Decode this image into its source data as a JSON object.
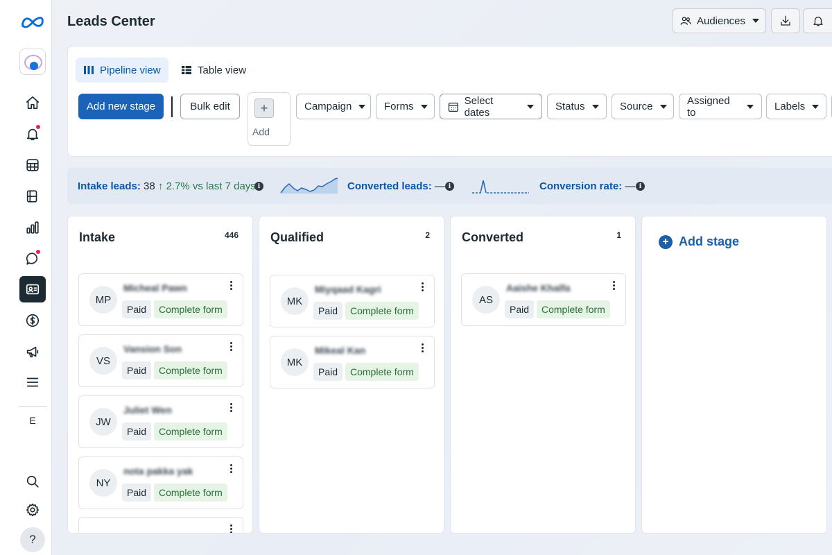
{
  "app": {
    "title": "Leads Center"
  },
  "header": {
    "audiences_label": "Audiences"
  },
  "rail": {
    "workspace_letter": "E",
    "help_label": "?"
  },
  "views": {
    "pipeline": "Pipeline view",
    "table": "Table view"
  },
  "toolbar": {
    "add_stage_button": "Add new stage",
    "bulk_edit": "Bulk edit",
    "add_label": "Add",
    "add_plus": "+",
    "filters": {
      "campaign": "Campaign",
      "forms": "Forms",
      "dates": "Select dates",
      "status": "Status",
      "source": "Source",
      "assigned": "Assigned to",
      "labels": "Labels"
    }
  },
  "stats": {
    "intake_label": "Intake leads:",
    "intake_value": "38",
    "intake_delta": "↑ 2.7% vs last 7 days",
    "converted_label": "Converted leads:",
    "converted_value": "—",
    "rate_label": "Conversion rate:",
    "rate_value": "—",
    "info_glyph": "i"
  },
  "columns": [
    {
      "title": "Intake",
      "count": "446",
      "cards": [
        {
          "initials": "MP",
          "name": "Micheal Pawn",
          "tag1": "Paid",
          "tag2": "Complete form"
        },
        {
          "initials": "VS",
          "name": "Vansion Son",
          "tag1": "Paid",
          "tag2": "Complete form"
        },
        {
          "initials": "JW",
          "name": "Juliet Wen",
          "tag1": "Paid",
          "tag2": "Complete form"
        },
        {
          "initials": "NY",
          "name": "nota pakka yak",
          "tag1": "Paid",
          "tag2": "Complete form"
        }
      ]
    },
    {
      "title": "Qualified",
      "count": "2",
      "cards": [
        {
          "initials": "MK",
          "name": "Miyqaad Kagri",
          "tag1": "Paid",
          "tag2": "Complete form"
        },
        {
          "initials": "MK",
          "name": "Mikeal Kan",
          "tag1": "Paid",
          "tag2": "Complete form"
        }
      ]
    },
    {
      "title": "Converted",
      "count": "1",
      "cards": [
        {
          "initials": "AS",
          "name": "Aaishe Khalfa",
          "tag1": "Paid",
          "tag2": "Complete form"
        }
      ]
    }
  ],
  "add_stage_column": {
    "label": "Add stage",
    "plus": "+"
  }
}
